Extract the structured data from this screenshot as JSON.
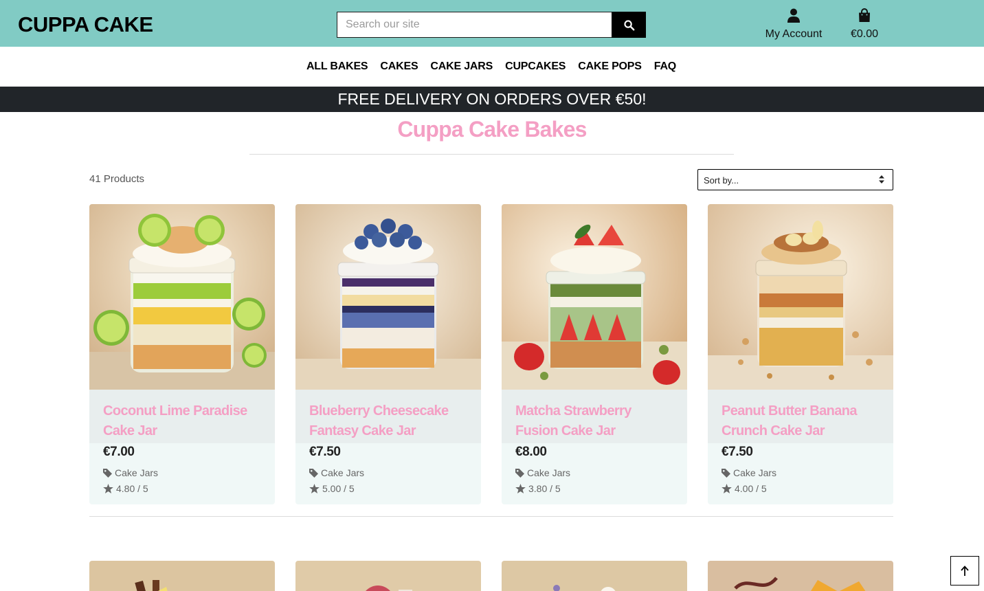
{
  "header": {
    "brand": "CUPPA CAKE",
    "search_placeholder": "Search our site",
    "search_icon": "search-icon",
    "account_label": "My Account",
    "account_icon": "user-icon",
    "bag_total": "€0.00",
    "bag_icon": "shopping-bag-icon",
    "bar_color": "#81cbc4"
  },
  "nav": {
    "items": [
      "ALL BAKES",
      "CAKES",
      "CAKE JARS",
      "CUPCAKES",
      "CAKE POPS",
      "FAQ"
    ]
  },
  "banner": {
    "text": "FREE DELIVERY ON ORDERS OVER €50!"
  },
  "main": {
    "title": "Cuppa Cake Bakes",
    "title_color": "#f49fc4",
    "product_count": "41 Products",
    "sort": {
      "selected": "Sort by..."
    }
  },
  "products": [
    {
      "name": "Coconut Lime Paradise Cake Jar",
      "price": "€7.00",
      "category": "Cake Jars",
      "rating": "4.80 / 5"
    },
    {
      "name": "Blueberry Cheesecake Fantasy Cake Jar",
      "price": "€7.50",
      "category": "Cake Jars",
      "rating": "5.00 / 5"
    },
    {
      "name": "Matcha Strawberry Fusion Cake Jar",
      "price": "€8.00",
      "category": "Cake Jars",
      "rating": "3.80 / 5"
    },
    {
      "name": "Peanut Butter Banana Crunch Cake Jar",
      "price": "€7.50",
      "category": "Cake Jars",
      "rating": "4.00 / 5"
    }
  ],
  "icons": {
    "category": "tag-icon",
    "rating": "star-icon",
    "back_to_top": "arrow-up-icon"
  }
}
